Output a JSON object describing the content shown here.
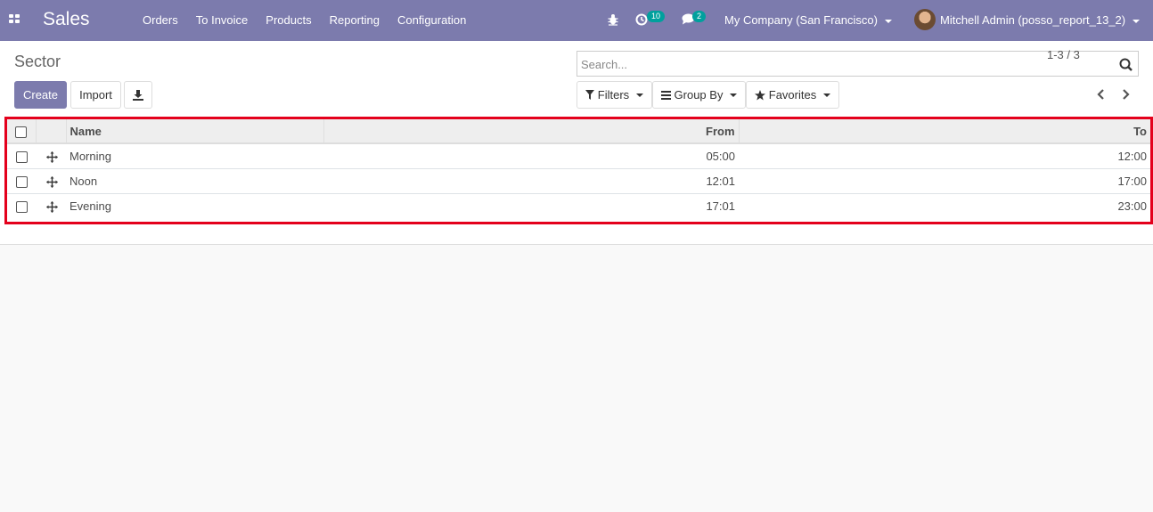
{
  "navbar": {
    "app_name": "Sales",
    "menu": [
      "Orders",
      "To Invoice",
      "Products",
      "Reporting",
      "Configuration"
    ],
    "activity_count": "10",
    "message_count": "2",
    "company": "My Company (San Francisco)",
    "user": "Mitchell Admin (posso_report_13_2)"
  },
  "control_panel": {
    "title": "Sector",
    "search_placeholder": "Search...",
    "create_label": "Create",
    "import_label": "Import",
    "filters_label": "Filters",
    "groupby_label": "Group By",
    "favorites_label": "Favorites",
    "pager": "1-3 / 3"
  },
  "list": {
    "columns": {
      "name": "Name",
      "from": "From",
      "to": "To"
    },
    "rows": [
      {
        "name": "Morning",
        "from": "05:00",
        "to": "12:00"
      },
      {
        "name": "Noon",
        "from": "12:01",
        "to": "17:00"
      },
      {
        "name": "Evening",
        "from": "17:01",
        "to": "23:00"
      }
    ]
  },
  "colors": {
    "navbar": "#7c7bad",
    "highlight": "#e4001c",
    "badge": "#00a09d"
  },
  "icons": [
    "apps-icon",
    "bug-icon",
    "activity-icon",
    "chat-icon",
    "search-icon",
    "download-icon",
    "filter-icon",
    "list-icon",
    "star-icon",
    "chevron-left-icon",
    "chevron-right-icon",
    "drag-handle-icon"
  ]
}
